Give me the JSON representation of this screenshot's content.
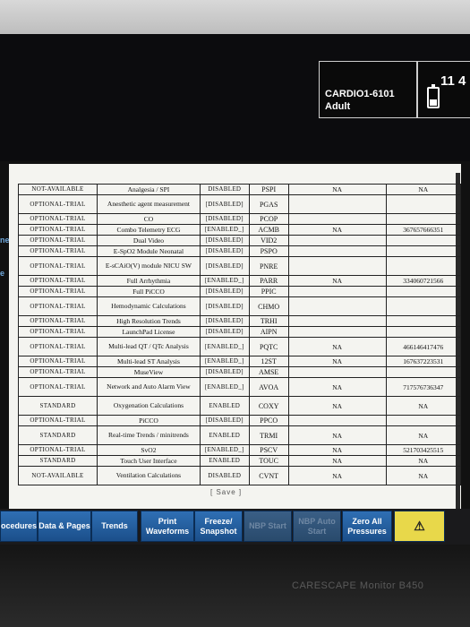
{
  "header": {
    "patient_id": "CARDIO1-6101",
    "patient_type": "Adult",
    "clock": "11 4"
  },
  "left_fragments": [
    "nent",
    "e"
  ],
  "table": {
    "rows": [
      {
        "status": "NOT-AVAILABLE",
        "feature": "Analgesia / SPI",
        "state": "DISABLED",
        "code": "PSPI",
        "na1": "NA",
        "num": "NA"
      },
      {
        "status": "OPTIONAL-TRIAL",
        "feature": "Anesthetic agent measurement",
        "state": "[DISABLED]",
        "code": "PGAS",
        "na1": "",
        "num": ""
      },
      {
        "status": "OPTIONAL-TRIAL",
        "feature": "CO",
        "state": "[DISABLED]",
        "code": "PCOP",
        "na1": "",
        "num": ""
      },
      {
        "status": "OPTIONAL-TRIAL",
        "feature": "Combo Telemetry ECG",
        "state": "[ENABLED_]",
        "code": "ACMB",
        "na1": "NA",
        "num": "367657666351"
      },
      {
        "status": "OPTIONAL-TRIAL",
        "feature": "Dual Video",
        "state": "[DISABLED]",
        "code": "VID2",
        "na1": "",
        "num": ""
      },
      {
        "status": "OPTIONAL-TRIAL",
        "feature": "E-SpO2 Module Neonatal",
        "state": "[DISABLED]",
        "code": "PSPO",
        "na1": "",
        "num": ""
      },
      {
        "status": "OPTIONAL-TRIAL",
        "feature": "E-sCAiO(V) module NICU SW",
        "state": "[DISABLED]",
        "code": "PNRE",
        "na1": "",
        "num": ""
      },
      {
        "status": "OPTIONAL-TRIAL",
        "feature": "Full Arrhythmia",
        "state": "[ENABLED_]",
        "code": "PARR",
        "na1": "NA",
        "num": "334060721566"
      },
      {
        "status": "OPTIONAL-TRIAL",
        "feature": "Full PiCCO",
        "state": "[DISABLED]",
        "code": "PPIC",
        "na1": "",
        "num": ""
      },
      {
        "status": "OPTIONAL-TRIAL",
        "feature": "Hemodynamic Calculations",
        "state": "[DISABLED]",
        "code": "CHMO",
        "na1": "",
        "num": ""
      },
      {
        "status": "OPTIONAL-TRIAL",
        "feature": "High Resolution Trends",
        "state": "[DISABLED]",
        "code": "TRHI",
        "na1": "",
        "num": ""
      },
      {
        "status": "OPTIONAL-TRIAL",
        "feature": "LaunchPad License",
        "state": "[DISABLED]",
        "code": "AIPN",
        "na1": "",
        "num": ""
      },
      {
        "status": "OPTIONAL-TRIAL",
        "feature": "Multi-lead QT / QTc Analysis",
        "state": "[ENABLED_]",
        "code": "PQTC",
        "na1": "NA",
        "num": "466146417476"
      },
      {
        "status": "OPTIONAL-TRIAL",
        "feature": "Multi-lead ST Analysis",
        "state": "[ENABLED_]",
        "code": "12ST",
        "na1": "NA",
        "num": "167637223531"
      },
      {
        "status": "OPTIONAL-TRIAL",
        "feature": "MuseView",
        "state": "[DISABLED]",
        "code": "AMSE",
        "na1": "",
        "num": ""
      },
      {
        "status": "OPTIONAL-TRIAL",
        "feature": "Network and Auto Alarm View",
        "state": "[ENABLED_]",
        "code": "AVOA",
        "na1": "NA",
        "num": "717576736347"
      },
      {
        "status": "STANDARD",
        "feature": "Oxygenation Calculations",
        "state": "ENABLED",
        "code": "COXY",
        "na1": "NA",
        "num": "NA"
      },
      {
        "status": "OPTIONAL-TRIAL",
        "feature": "PiCCO",
        "state": "[DISABLED]",
        "code": "PPCO",
        "na1": "",
        "num": ""
      },
      {
        "status": "STANDARD",
        "feature": "Real-time Trends / minitrends",
        "state": "ENABLED",
        "code": "TRMI",
        "na1": "NA",
        "num": "NA"
      },
      {
        "status": "OPTIONAL-TRIAL",
        "feature": "SvO2",
        "state": "[ENABLED_]",
        "code": "PSCV",
        "na1": "NA",
        "num": "521703425515"
      },
      {
        "status": "STANDARD",
        "feature": "Touch User Interface",
        "state": "ENABLED",
        "code": "TOUC",
        "na1": "NA",
        "num": "NA"
      },
      {
        "status": "NOT-AVAILABLE",
        "feature": "Ventilation Calculations",
        "state": "DISABLED",
        "code": "CVNT",
        "na1": "NA",
        "num": "NA"
      }
    ],
    "save_label": "[ Save ]"
  },
  "buttons": [
    {
      "label": "ocedures",
      "enabled": true
    },
    {
      "label": "Data & Pages",
      "enabled": true
    },
    {
      "label": "Trends",
      "enabled": true
    },
    {
      "label": "Print Waveforms",
      "enabled": true
    },
    {
      "label": "Freeze/ Snapshot",
      "enabled": true
    },
    {
      "label": "NBP Start",
      "enabled": false
    },
    {
      "label": "NBP Auto Start",
      "enabled": false
    },
    {
      "label": "Zero All Pressures",
      "enabled": true
    },
    {
      "label": "⚠",
      "enabled": true
    }
  ],
  "brand": "CARESCAPE Monitor B450"
}
